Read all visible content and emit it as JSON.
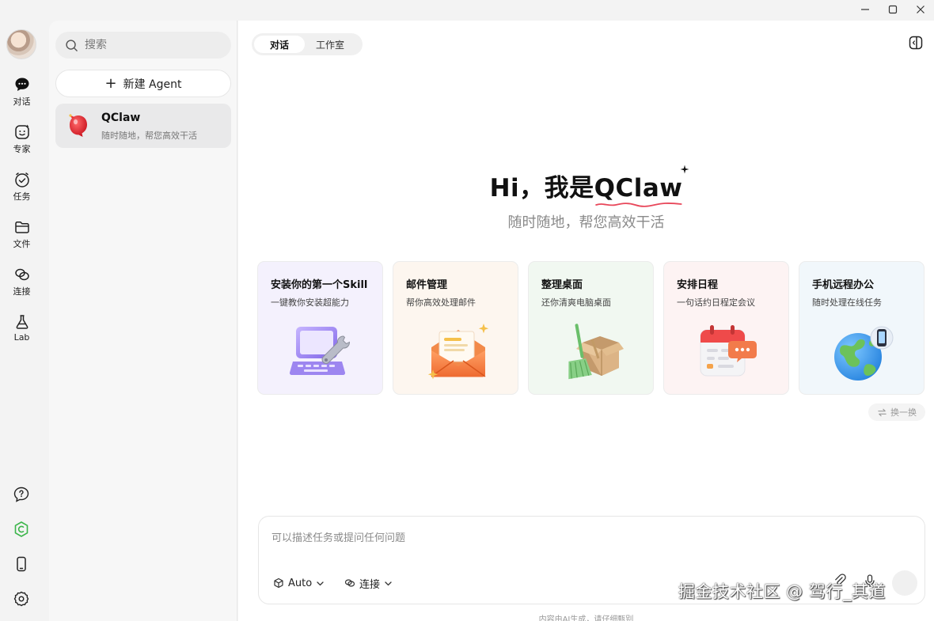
{
  "window": {
    "controls": [
      "minimize-icon",
      "maximize-icon",
      "close-icon"
    ]
  },
  "rail": {
    "items": [
      {
        "label": "对话",
        "icon": "chat-bubble-icon"
      },
      {
        "label": "专家",
        "icon": "expert-face-icon"
      },
      {
        "label": "任务",
        "icon": "task-check-icon"
      },
      {
        "label": "文件",
        "icon": "folder-icon"
      },
      {
        "label": "连接",
        "icon": "link-icon"
      },
      {
        "label": "Lab",
        "icon": "flask-icon"
      }
    ],
    "bottom_icons": [
      "help-icon",
      "claw-logo-icon",
      "phone-icon",
      "settings-icon"
    ],
    "accent_green": "#3bb54a"
  },
  "sidebar": {
    "search_placeholder": "搜索",
    "new_agent_label": "新建 Agent",
    "agent": {
      "name": "QClaw",
      "description": "随时随地，帮您高效干活"
    }
  },
  "main": {
    "tabs": [
      {
        "label": "对话",
        "active": true
      },
      {
        "label": "工作室",
        "active": false
      }
    ],
    "hero": {
      "greeting": "Hi，我是",
      "brand": "QClaw",
      "subtitle": "随时随地，帮您高效干活"
    },
    "cards": [
      {
        "title": "安装你的第一个Skill",
        "subtitle": "一键教你安装超能力",
        "icon": "laptop-wrench-icon",
        "bg": "#f4f1fd"
      },
      {
        "title": "邮件管理",
        "subtitle": "帮你高效处理邮件",
        "icon": "envelope-icon",
        "bg": "#fdf6ef"
      },
      {
        "title": "整理桌面",
        "subtitle": "还你清爽电脑桌面",
        "icon": "box-broom-icon",
        "bg": "#f1f8f1"
      },
      {
        "title": "安排日程",
        "subtitle": "一句话约日程定会议",
        "icon": "calendar-chat-icon",
        "bg": "#fdf3f3"
      },
      {
        "title": "手机远程办公",
        "subtitle": "随时处理在线任务",
        "icon": "globe-phone-icon",
        "bg": "#f1f7fb"
      }
    ],
    "refresh_label": "换一换",
    "composer": {
      "placeholder": "可以描述任务或提问任何问题",
      "model_label": "Auto",
      "connect_label": "连接"
    },
    "disclaimer": "内容由AI生成，请仔细甄别"
  },
  "watermark": "掘金技术社区 @ 驾行_其道"
}
